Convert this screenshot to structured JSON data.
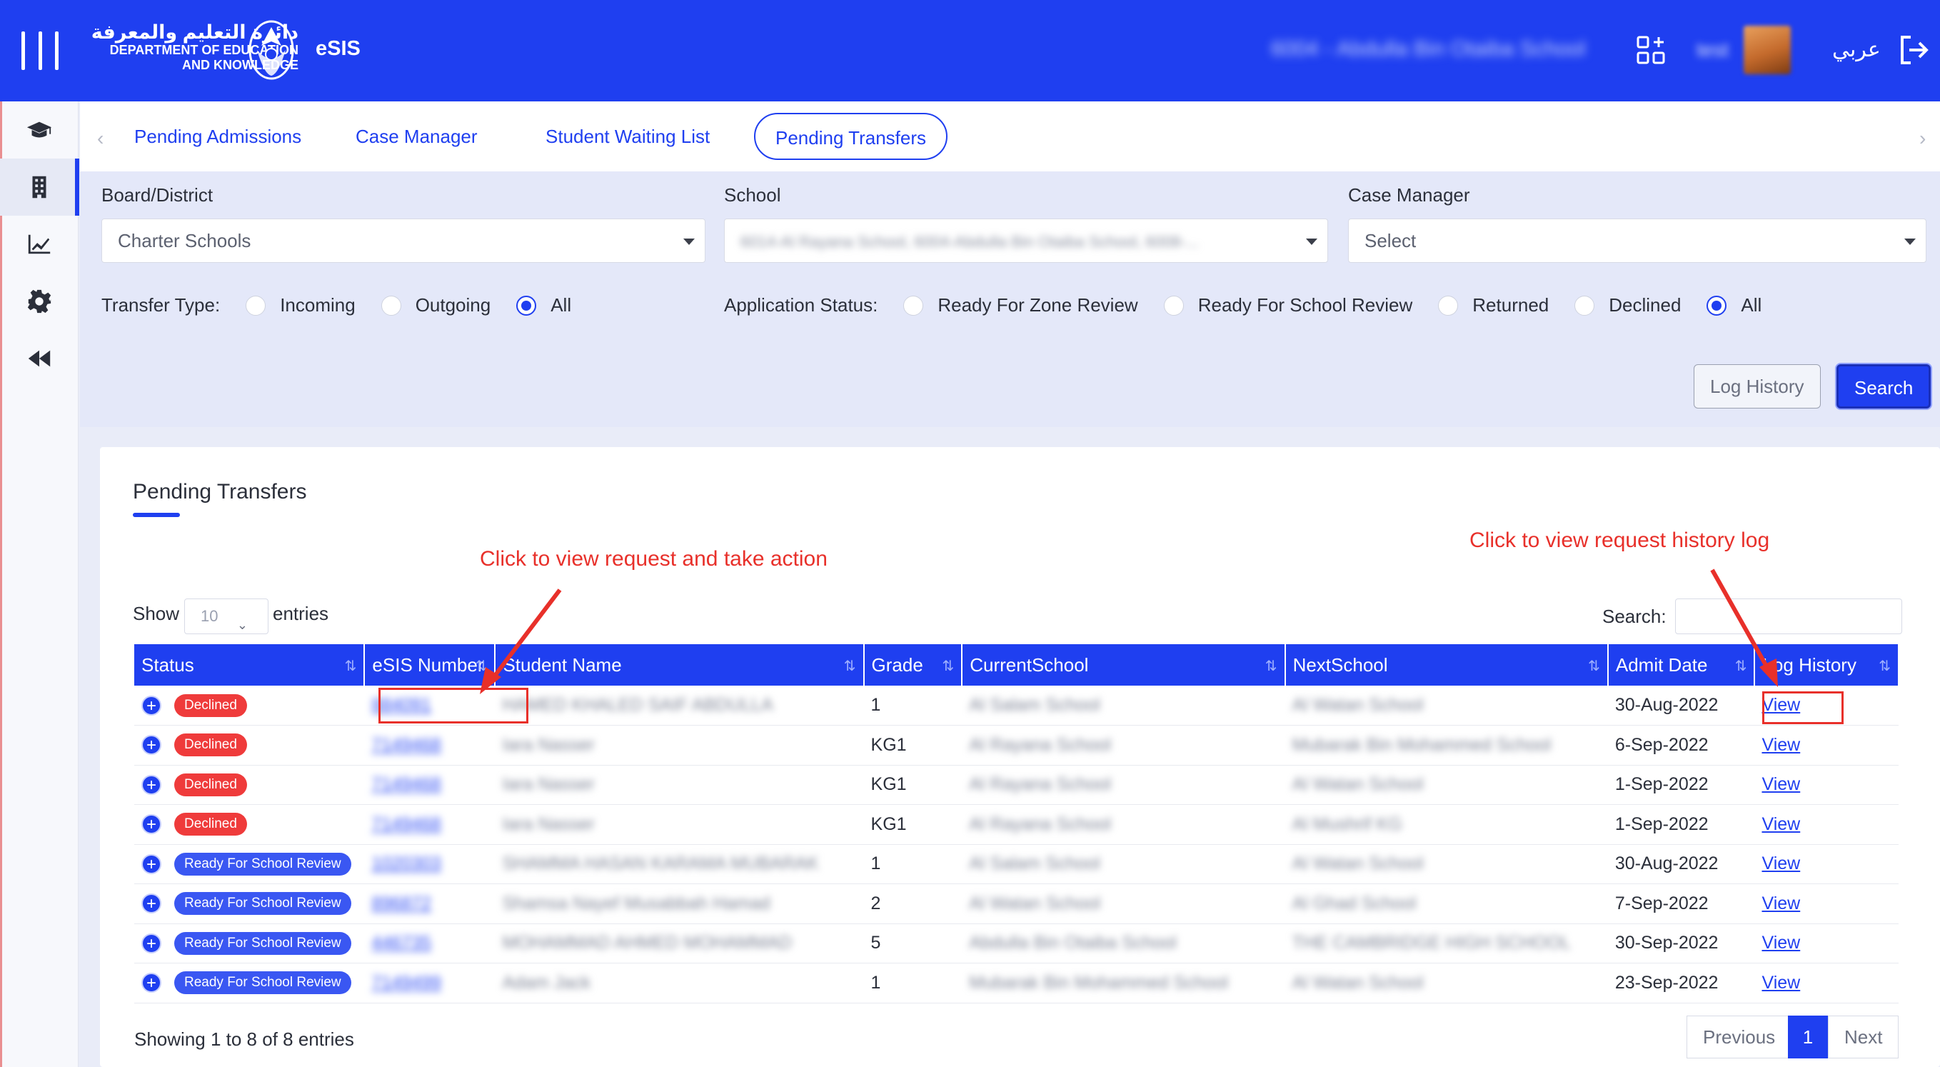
{
  "header": {
    "dept_arabic": "دائرة التعليم والمعرفة",
    "dept_english_line1": "DEPARTMENT OF EDUCATION",
    "dept_english_line2": "AND KNOWLEDGE",
    "app_name": "eSIS",
    "school_name": "6004 - Abdulla Bin Otaiba School",
    "user_name": "test",
    "language_toggle": "عربي",
    "icons": [
      "menu-icon",
      "emblem-icon",
      "apps-grid-icon",
      "logout-icon"
    ],
    "background_color": "#1f3ff0"
  },
  "sidebar": {
    "items": [
      {
        "icon": "graduation-cap-icon"
      },
      {
        "icon": "building-icon",
        "active": true
      },
      {
        "icon": "chart-icon"
      },
      {
        "icon": "gear-icon"
      },
      {
        "icon": "rewind-icon"
      }
    ]
  },
  "tabs": [
    {
      "label": "Pending Admissions"
    },
    {
      "label": "Case Manager"
    },
    {
      "label": "Student Waiting List"
    },
    {
      "label": "Pending Transfers",
      "active": true
    }
  ],
  "filters": {
    "board_label": "Board/District",
    "board_value": "Charter Schools",
    "school_label": "School",
    "school_value": "6014-Al Rayana School, 6004-Abdulla Bin Otaiba School, 6008-...",
    "case_manager_label": "Case Manager",
    "case_manager_value": "Select",
    "transfer_type_label": "Transfer Type:",
    "transfer_types": [
      {
        "label": "Incoming",
        "selected": false
      },
      {
        "label": "Outgoing",
        "selected": false
      },
      {
        "label": "All",
        "selected": true
      }
    ],
    "app_status_label": "Application Status:",
    "app_statuses": [
      {
        "label": "Ready For Zone Review",
        "selected": false
      },
      {
        "label": "Ready For School Review",
        "selected": false
      },
      {
        "label": "Returned",
        "selected": false
      },
      {
        "label": "Declined",
        "selected": false
      },
      {
        "label": "All",
        "selected": true
      }
    ],
    "log_history_button": "Log History",
    "search_button": "Search"
  },
  "results": {
    "title": "Pending Transfers",
    "show_label": "Show",
    "entries_value": "10",
    "entries_label": "entries",
    "search_label": "Search:",
    "search_value": "",
    "columns": [
      "Status",
      "eSIS Number",
      "Student Name",
      "Grade",
      "CurrentSchool",
      "NextSchool",
      "Admit Date",
      "Log History"
    ],
    "rows": [
      {
        "status": "Declined",
        "esis": "884091",
        "name": "HAMED KHALED SAIF ABDULLA",
        "grade": "1",
        "current": "Al Salam School",
        "next": "Al Watan School",
        "date": "30-Aug-2022",
        "log": "View"
      },
      {
        "status": "Declined",
        "esis": "7149468",
        "name": "Iara Nasser",
        "grade": "KG1",
        "current": "Al Rayana School",
        "next": "Mubarak Bin Mohammed School",
        "date": "6-Sep-2022",
        "log": "View"
      },
      {
        "status": "Declined",
        "esis": "7149468",
        "name": "Iara Nasser",
        "grade": "KG1",
        "current": "Al Rayana School",
        "next": "Al Watan School",
        "date": "1-Sep-2022",
        "log": "View"
      },
      {
        "status": "Declined",
        "esis": "7149468",
        "name": "Iara Nasser",
        "grade": "KG1",
        "current": "Al Rayana School",
        "next": "Al Mushrif KG",
        "date": "1-Sep-2022",
        "log": "View"
      },
      {
        "status": "Ready For School Review",
        "esis": "1020303",
        "name": "SHAMMA HASAN KARAMA MUBARAK",
        "grade": "1",
        "current": "Al Salam School",
        "next": "Al Watan School",
        "date": "30-Aug-2022",
        "log": "View"
      },
      {
        "status": "Ready For School Review",
        "esis": "896872",
        "name": "Shamsa Nayef Musabbah Hamad",
        "grade": "2",
        "current": "Al Watan School",
        "next": "Al Ghad School",
        "date": "7-Sep-2022",
        "log": "View"
      },
      {
        "status": "Ready For School Review",
        "esis": "446735",
        "name": "MOHAMMAD AHMED MOHAMMAD",
        "grade": "5",
        "current": "Abdulla Bin Otaiba School",
        "next": "THE CAMBRIDGE HIGH SCHOOL",
        "date": "30-Sep-2022",
        "log": "View"
      },
      {
        "status": "Ready For School Review",
        "esis": "7149499",
        "name": "Adam Jack",
        "grade": "1",
        "current": "Mubarak Bin Mohammed School",
        "next": "Al Watan School",
        "date": "23-Sep-2022",
        "log": "View"
      }
    ],
    "status_colors": {
      "Declined": "#ef3b3b",
      "Ready For School Review": "#3a57f2"
    },
    "footer_info": "Showing 1 to 8 of 8 entries",
    "pagination": {
      "previous": "Previous",
      "current": "1",
      "next": "Next"
    }
  },
  "annotations": {
    "left_note": "Click to view request and take action",
    "right_note": "Click to view request history log"
  }
}
